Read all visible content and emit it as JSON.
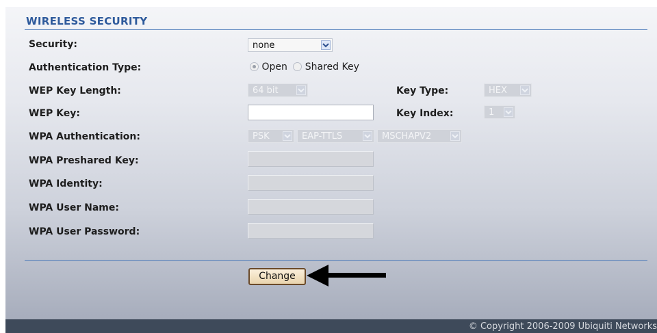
{
  "section_title": "WIRELESS SECURITY",
  "labels": {
    "security": "Security:",
    "auth_type": "Authentication Type:",
    "wep_key_length": "WEP Key Length:",
    "key_type": "Key Type:",
    "wep_key": "WEP Key:",
    "key_index": "Key Index:",
    "wpa_auth": "WPA Authentication:",
    "wpa_preshared": "WPA Preshared Key:",
    "wpa_identity": "WPA Identity:",
    "wpa_username": "WPA User Name:",
    "wpa_password": "WPA User Password:"
  },
  "values": {
    "security": "none",
    "wep_key_length": "64 bit",
    "key_type": "HEX",
    "key_index": "1",
    "wpa_auth_psk": "PSK",
    "wpa_auth_eap": "EAP-TTLS",
    "wpa_auth_mschap": "MSCHAPV2",
    "wep_key": "",
    "wpa_preshared": "",
    "wpa_identity": "",
    "wpa_username": "",
    "wpa_password": ""
  },
  "auth_options": {
    "open": "Open",
    "shared": "Shared Key",
    "selected": "Open"
  },
  "change_button": "Change",
  "footer": "© Copyright 2006-2009 Ubiquiti Networks",
  "icons": {
    "dropdown": "chevron-down-icon",
    "pointer": "arrow-left-icon"
  },
  "colors": {
    "title": "#2e5a9c",
    "rule": "#4a78b8",
    "footer_bg": "#3e4a5a",
    "arrow": "#000000"
  }
}
